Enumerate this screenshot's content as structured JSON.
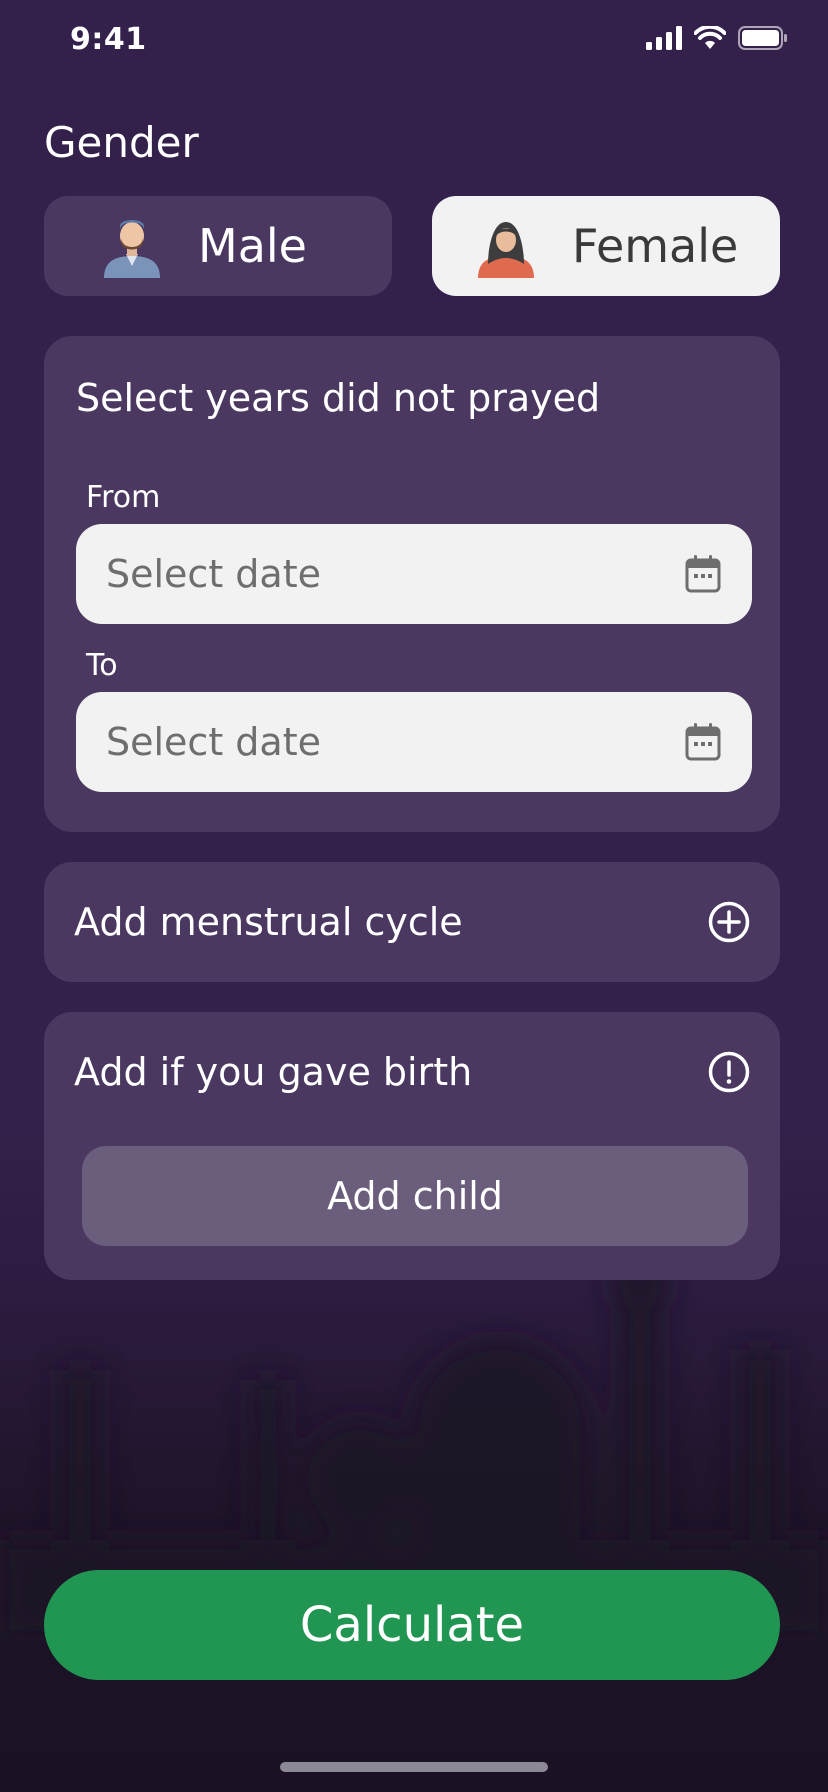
{
  "status_bar": {
    "time": "9:41"
  },
  "gender": {
    "title": "Gender",
    "male_label": "Male",
    "female_label": "Female",
    "selected": "female"
  },
  "years_card": {
    "title": "Select years did not prayed",
    "from_label": "From",
    "from_placeholder": "Select date",
    "to_label": "To",
    "to_placeholder": "Select date"
  },
  "menstrual": {
    "label": "Add menstrual cycle",
    "icon": "plus-circle-icon"
  },
  "birth": {
    "label": "Add if you gave birth",
    "icon": "info-circle-icon",
    "add_child_label": "Add child"
  },
  "calculate_label": "Calculate",
  "colors": {
    "background": "#34214b",
    "card": "#4a3860",
    "selected_pill": "#f2f2f2",
    "add_child_button": "#6b5e7c",
    "accent_green": "#219653"
  }
}
